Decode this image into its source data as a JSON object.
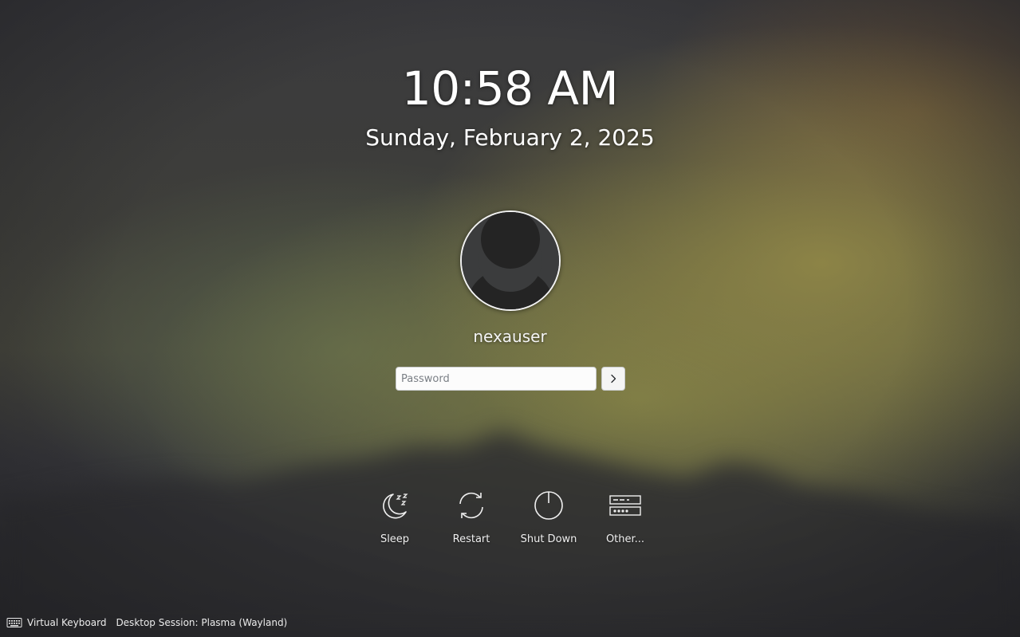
{
  "clock": {
    "time": "10:58 AM",
    "date": "Sunday, February 2, 2025"
  },
  "user": {
    "name": "nexauser",
    "avatar_icon": "user-avatar-placeholder"
  },
  "login": {
    "password_placeholder": "Password",
    "password_value": "",
    "submit_icon": "chevron-right-icon"
  },
  "actions": [
    {
      "label": "Sleep",
      "icon": "sleep-icon"
    },
    {
      "label": "Restart",
      "icon": "restart-icon"
    },
    {
      "label": "Shut Down",
      "icon": "shutdown-icon"
    },
    {
      "label": "Other...",
      "icon": "other-sessions-icon"
    }
  ],
  "footer": {
    "virtual_keyboard": "Virtual Keyboard",
    "session": "Desktop Session: Plasma (Wayland)"
  },
  "colors": {
    "text": "#ffffff",
    "input_bg": "#fcfcfc",
    "input_border": "#c9cbcd",
    "avatar_ring": "#f2f2f2"
  }
}
